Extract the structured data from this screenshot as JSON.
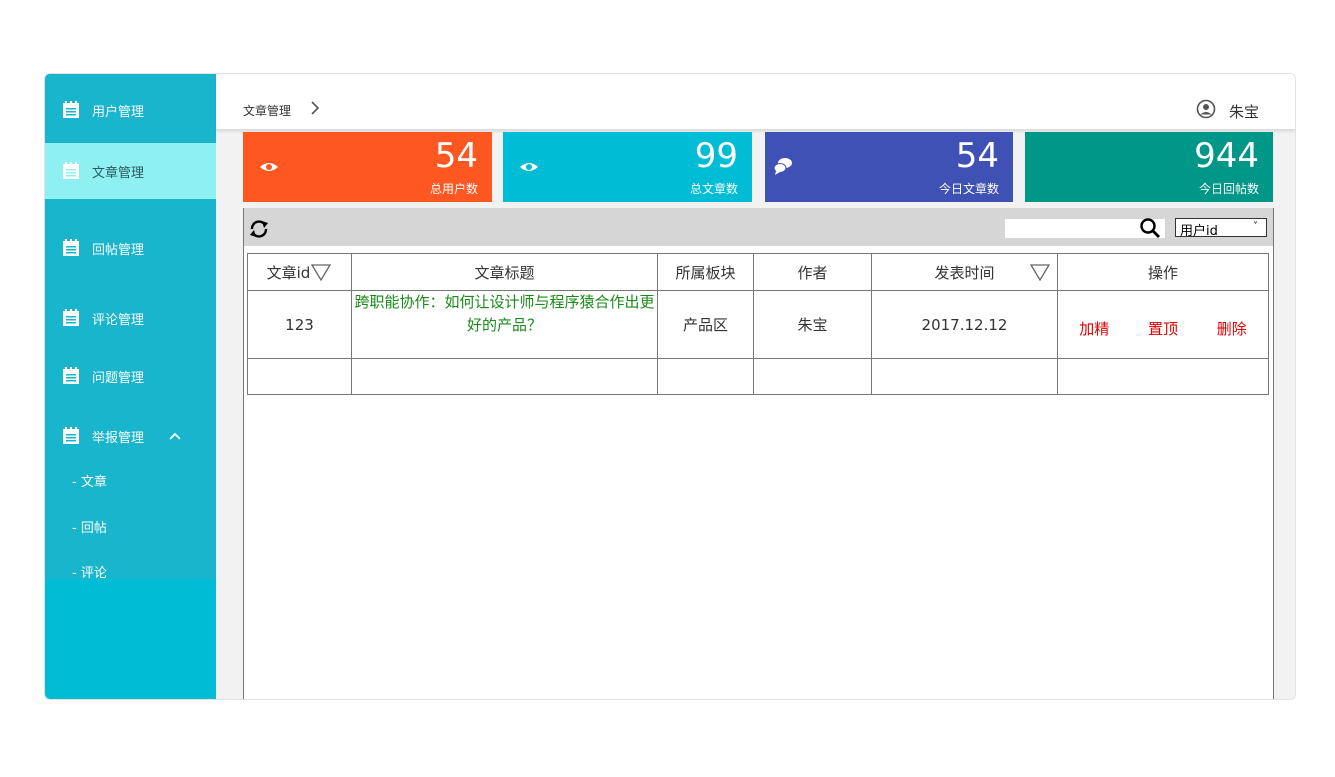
{
  "sidebar": {
    "items": [
      {
        "label": "用户管理",
        "icon": "notepad-icon"
      },
      {
        "label": "文章管理",
        "icon": "notepad-icon"
      },
      {
        "label": "回帖管理",
        "icon": "notepad-icon"
      },
      {
        "label": "评论管理",
        "icon": "notepad-icon"
      },
      {
        "label": "问题管理",
        "icon": "notepad-icon"
      },
      {
        "label": "举报管理",
        "icon": "notepad-icon"
      }
    ],
    "active_index": 1,
    "subitems": [
      "- 文章",
      "- 回帖",
      "- 评论"
    ]
  },
  "header": {
    "breadcrumb": "文章管理",
    "user_name": "朱宝"
  },
  "stats": [
    {
      "value": "54",
      "label": "总用户数",
      "icon": "eye-icon",
      "color": "#ff5722"
    },
    {
      "value": "99",
      "label": "总文章数",
      "icon": "eye-icon",
      "color": "#00bcd4"
    },
    {
      "value": "54",
      "label": "今日文章数",
      "icon": "chat-bubbles-icon",
      "color": "#3f51b5"
    },
    {
      "value": "944",
      "label": "今日回帖数",
      "icon": "",
      "color": "#009688"
    }
  ],
  "toolbar": {
    "search_placeholder": "",
    "select_value": "用户id"
  },
  "table": {
    "headers": [
      "文章id",
      "文章标题",
      "所属板块",
      "作者",
      "发表时间",
      "操作"
    ],
    "rows": [
      {
        "id": "123",
        "title": "跨职能协作：如何让设计师与程序猿合作出更好的产品？",
        "section": "产品区",
        "author": "朱宝",
        "date": "2017.12.12",
        "actions": [
          "加精",
          "置顶",
          "删除"
        ]
      }
    ]
  }
}
